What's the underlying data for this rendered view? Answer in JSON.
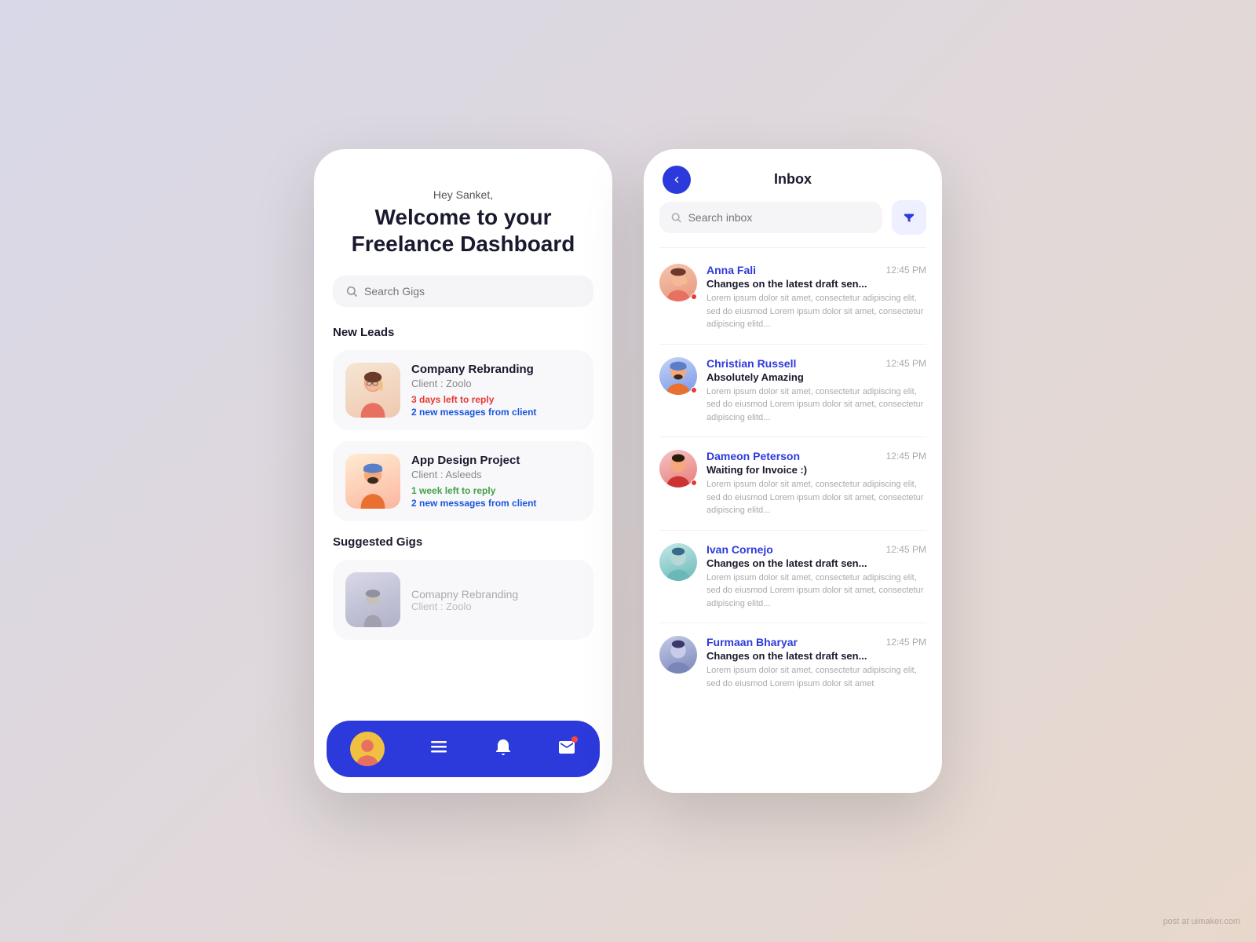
{
  "left_phone": {
    "greeting_sub": "Hey Sanket,",
    "greeting_main": "Welcome to your\nFreelance Dashboard",
    "search_placeholder": "Search Gigs",
    "new_leads_title": "New Leads",
    "leads": [
      {
        "title": "Company Rebranding",
        "client": "Client : Zoolo",
        "deadline": "3 days left to reply",
        "deadline_color": "red",
        "messages": "2 new messages from client",
        "avatar_color": "company"
      },
      {
        "title": "App Design Project",
        "client": "Client : Asleeds",
        "deadline": "1 week left to reply",
        "deadline_color": "green",
        "messages": "2 new messages from client",
        "avatar_color": "app"
      }
    ],
    "suggested_title": "Suggested Gigs",
    "suggested": [
      {
        "title": "Comapny Rebranding",
        "client": "Client : Zoolo"
      }
    ],
    "nav": {
      "icons": [
        "profile",
        "menu",
        "bell",
        "mail"
      ]
    }
  },
  "right_phone": {
    "back_label": "‹",
    "inbox_title": "Inbox",
    "search_placeholder": "Search inbox",
    "messages": [
      {
        "name": "Anna Fali",
        "time": "12:45 PM",
        "subject": "Changes on the latest draft sen...",
        "preview": "Lorem ipsum dolor sit amet, consectetur adipiscing elit, sed do eiusmod Lorem ipsum dolor sit amet, consectetur adipiscing elitd...",
        "avatar_color": "av-pink",
        "unread": true
      },
      {
        "name": "Christian Russell",
        "time": "12:45 PM",
        "subject": "Absolutely Amazing",
        "preview": "Lorem ipsum dolor sit amet, consectetur adipiscing elit, sed do eiusmod Lorem ipsum dolor sit amet, consectetur adipiscing elitd...",
        "avatar_color": "av-blue",
        "unread": true
      },
      {
        "name": "Dameon Peterson",
        "time": "12:45 PM",
        "subject": "Waiting for Invoice :)",
        "preview": "Lorem ipsum dolor sit amet, consectetur adipiscing elit, sed do eiusmod Lorem ipsum dolor sit amet, consectetur adipiscing elitd...",
        "avatar_color": "av-red",
        "unread": true
      },
      {
        "name": "Ivan Cornejo",
        "time": "12:45 PM",
        "subject": "Changes on the latest draft sen...",
        "preview": "Lorem ipsum dolor sit amet, consectetur adipiscing elit, sed do eiusmod Lorem ipsum dolor sit amet, consectetur adipiscing elitd...",
        "avatar_color": "av-teal",
        "unread": false
      },
      {
        "name": "Furmaan Bharyar",
        "time": "12:45 PM",
        "subject": "Changes on the latest draft sen...",
        "preview": "Lorem ipsum dolor sit amet, consectetur adipiscing elit, sed do eiusmod Lorem ipsum dolor sit amet",
        "avatar_color": "av-navy",
        "unread": false
      }
    ]
  },
  "watermark": "post at uimaker.com"
}
